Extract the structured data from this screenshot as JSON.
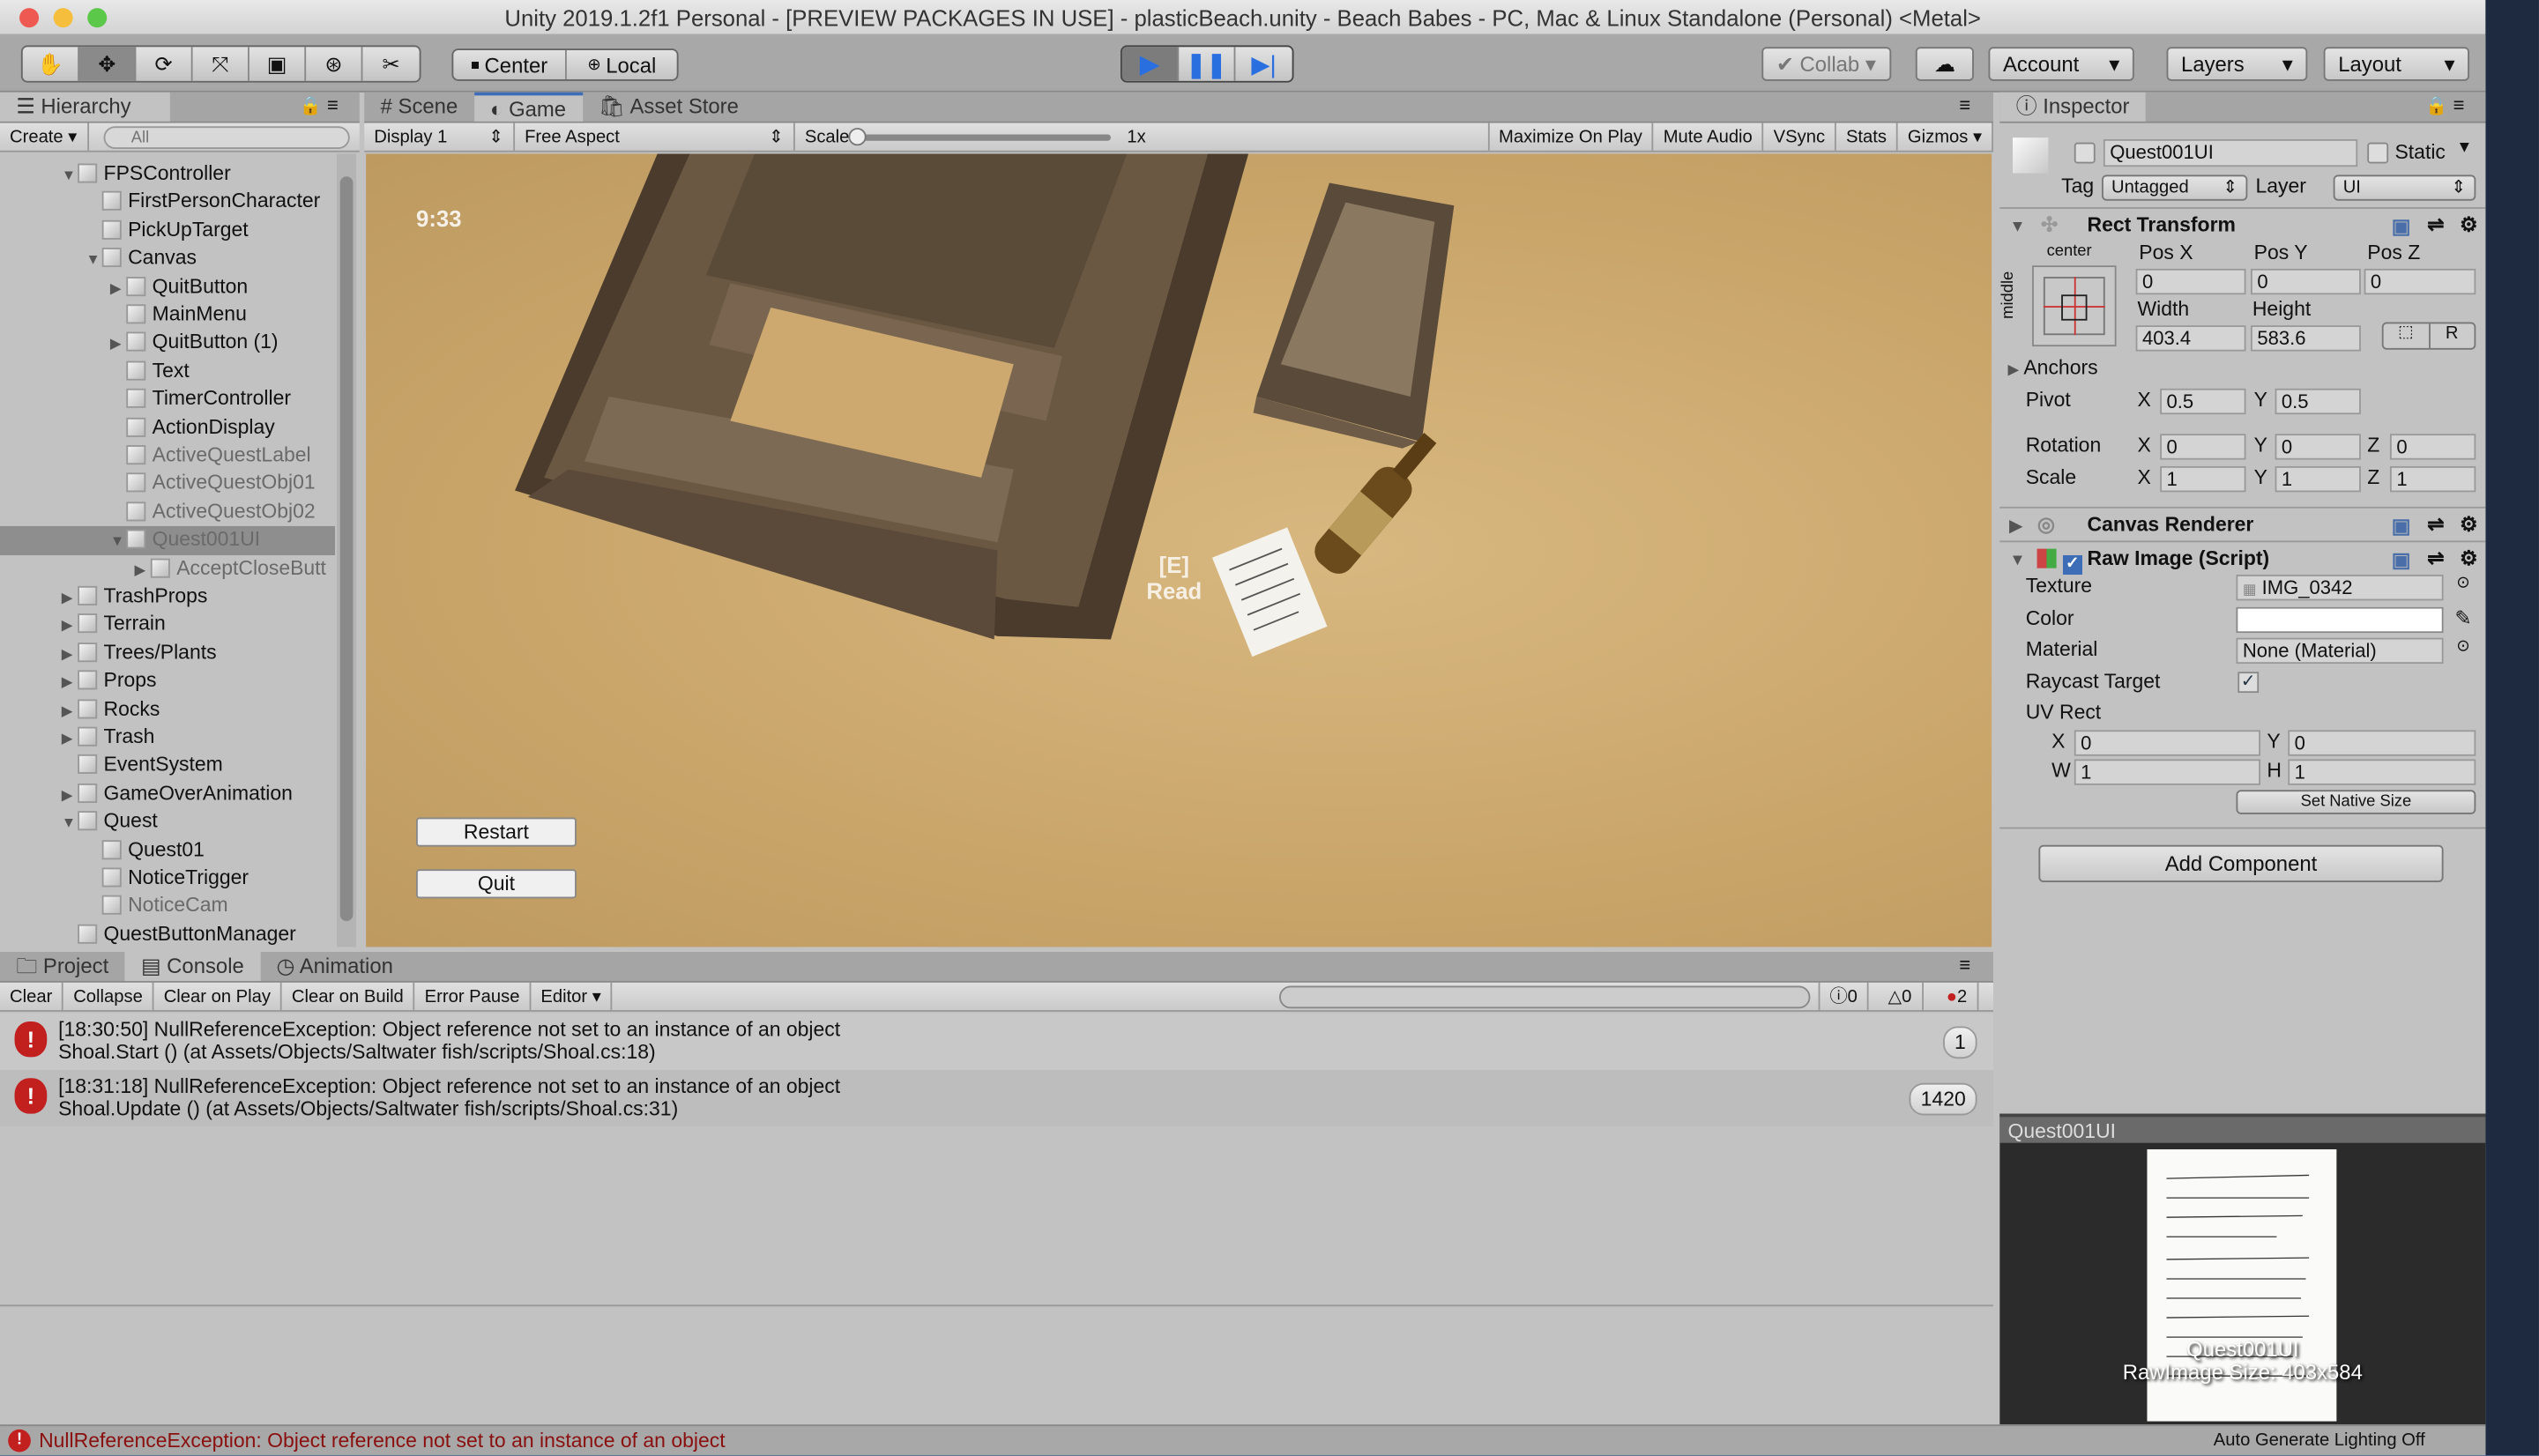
{
  "window": {
    "title": "Unity 2019.1.2f1 Personal - [PREVIEW PACKAGES IN USE] - plasticBeach.unity - Beach Babes - PC, Mac & Linux Standalone (Personal) <Metal>"
  },
  "toolbar": {
    "tools": [
      "hand-icon",
      "move-icon",
      "rotate-icon",
      "scale-icon",
      "rect-icon",
      "transform-icon",
      "custom-tool-icon"
    ],
    "pivot": "Center",
    "space": "Local",
    "collab": "Collab",
    "account": "Account",
    "layers": "Layers",
    "layout": "Layout"
  },
  "hierarchy": {
    "tab": "Hierarchy",
    "create": "Create",
    "search_placeholder": "All",
    "items": [
      {
        "label": "FPSController",
        "level": 1,
        "arrow": "down",
        "active": true
      },
      {
        "label": "FirstPersonCharacter",
        "level": 2,
        "arrow": "",
        "active": true
      },
      {
        "label": "PickUpTarget",
        "level": 2,
        "arrow": "",
        "active": true
      },
      {
        "label": "Canvas",
        "level": 2,
        "arrow": "down",
        "active": true
      },
      {
        "label": "QuitButton",
        "level": 3,
        "arrow": "right",
        "active": true
      },
      {
        "label": "MainMenu",
        "level": 3,
        "arrow": "",
        "active": true
      },
      {
        "label": "QuitButton (1)",
        "level": 3,
        "arrow": "right",
        "active": true
      },
      {
        "label": "Text",
        "level": 3,
        "arrow": "",
        "active": true
      },
      {
        "label": "TimerController",
        "level": 3,
        "arrow": "",
        "active": true
      },
      {
        "label": "ActionDisplay",
        "level": 3,
        "arrow": "",
        "active": true
      },
      {
        "label": "ActiveQuestLabel",
        "level": 3,
        "arrow": "",
        "active": false
      },
      {
        "label": "ActiveQuestObj01",
        "level": 3,
        "arrow": "",
        "active": false
      },
      {
        "label": "ActiveQuestObj02",
        "level": 3,
        "arrow": "",
        "active": false
      },
      {
        "label": "Quest001UI",
        "level": 3,
        "arrow": "down",
        "active": false,
        "selected": true
      },
      {
        "label": "AcceptCloseButt",
        "level": 4,
        "arrow": "right",
        "active": false
      },
      {
        "label": "TrashProps",
        "level": 1,
        "arrow": "right",
        "active": true
      },
      {
        "label": "Terrain",
        "level": 1,
        "arrow": "right",
        "active": true
      },
      {
        "label": "Trees/Plants",
        "level": 1,
        "arrow": "right",
        "active": true
      },
      {
        "label": "Props",
        "level": 1,
        "arrow": "right",
        "active": true
      },
      {
        "label": "Rocks",
        "level": 1,
        "arrow": "right",
        "active": true
      },
      {
        "label": "Trash",
        "level": 1,
        "arrow": "right",
        "active": true
      },
      {
        "label": "EventSystem",
        "level": 1,
        "arrow": "",
        "active": true
      },
      {
        "label": "GameOverAnimation",
        "level": 1,
        "arrow": "right",
        "active": true
      },
      {
        "label": "Quest",
        "level": 1,
        "arrow": "down",
        "active": true
      },
      {
        "label": "Quest01",
        "level": 2,
        "arrow": "",
        "active": true
      },
      {
        "label": "NoticeTrigger",
        "level": 2,
        "arrow": "",
        "active": true
      },
      {
        "label": "NoticeCam",
        "level": 2,
        "arrow": "",
        "active": false
      },
      {
        "label": "QuestButtonManager",
        "level": 1,
        "arrow": "",
        "active": true
      }
    ]
  },
  "game": {
    "tabs": [
      "Scene",
      "Game",
      "Asset Store"
    ],
    "display": "Display 1",
    "aspect": "Free Aspect",
    "scale_label": "Scale",
    "scale_value": "1x",
    "toggles": [
      "Maximize On Play",
      "Mute Audio",
      "VSync",
      "Stats",
      "Gizmos"
    ],
    "timer": "9:33",
    "prompt_key": "[E]",
    "prompt_action": "Read",
    "restart": "Restart",
    "quit": "Quit"
  },
  "inspector": {
    "tab": "Inspector",
    "name": "Quest001UI",
    "static": "Static",
    "tag_label": "Tag",
    "tag": "Untagged",
    "layer_label": "Layer",
    "layer": "UI",
    "rect": {
      "title": "Rect Transform",
      "anchor_h": "center",
      "anchor_v": "middle",
      "posx_l": "Pos X",
      "posy_l": "Pos Y",
      "posz_l": "Pos Z",
      "posx": "0",
      "posy": "0",
      "posz": "0",
      "width_l": "Width",
      "height_l": "Height",
      "width": "403.4",
      "height": "583.6",
      "r": "R",
      "anchors": "Anchors",
      "pivot_l": "Pivot",
      "pivot_x": "0.5",
      "pivot_y": "0.5",
      "rotation_l": "Rotation",
      "rot_x": "0",
      "rot_y": "0",
      "rot_z": "0",
      "scale_l": "Scale",
      "sc_x": "1",
      "sc_y": "1",
      "sc_z": "1",
      "x": "X",
      "y": "Y",
      "z": "Z"
    },
    "canvas_renderer": "Canvas Renderer",
    "raw_image": {
      "title": "Raw Image (Script)",
      "texture_l": "Texture",
      "texture": "IMG_0342",
      "color_l": "Color",
      "material_l": "Material",
      "material": "None (Material)",
      "raycast_l": "Raycast Target",
      "uvrect_l": "UV Rect",
      "uv_x": "0",
      "uv_y": "0",
      "uv_w": "1",
      "uv_h": "1",
      "w": "W",
      "h": "H",
      "native": "Set Native Size"
    },
    "add_component": "Add Component",
    "preview_title": "Quest001UI",
    "preview_name": "Quest001UI",
    "preview_size": "RawImage Size: 403x584"
  },
  "console": {
    "tabs": [
      "Project",
      "Console",
      "Animation"
    ],
    "buttons": [
      "Clear",
      "Collapse",
      "Clear on Play",
      "Clear on Build",
      "Error Pause",
      "Editor"
    ],
    "info_count": "0",
    "warn_count": "0",
    "error_count": "2",
    "entries": [
      {
        "line1": "[18:30:50] NullReferenceException: Object reference not set to an instance of an object",
        "line2": "Shoal.Start () (at Assets/Objects/Saltwater fish/scripts/Shoal.cs:18)",
        "count": "1"
      },
      {
        "line1": "[18:31:18] NullReferenceException: Object reference not set to an instance of an object",
        "line2": "Shoal.Update () (at Assets/Objects/Saltwater fish/scripts/Shoal.cs:31)",
        "count": "1420"
      }
    ]
  },
  "status": {
    "message": "NullReferenceException: Object reference not set to an instance of an object",
    "lighting": "Auto Generate Lighting Off"
  }
}
